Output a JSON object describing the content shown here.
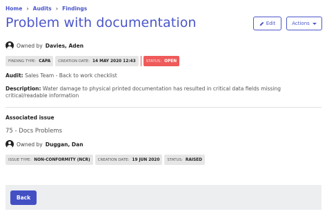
{
  "breadcrumb": [
    "Home",
    "Audits",
    "Findings"
  ],
  "title": "Problem with documentation",
  "actions": {
    "edit_label": "Edit",
    "actions_label": "Actions"
  },
  "finding": {
    "owner_prefix": "Owned by",
    "owner_name": "Davies, Aden",
    "tags": [
      {
        "label": "FINDING TYPE:",
        "value": "CAPA"
      },
      {
        "label": "CREATION DATE:",
        "value": "14 MAY 2020 12:43"
      },
      {
        "label": "STATUS:",
        "value": "OPEN"
      }
    ],
    "audit_label": "Audit:",
    "audit_value": "Sales Team - Back to work checklist",
    "description_label": "Description:",
    "description_value": "Water damage to physical printed documentation has resulted in critical data fields missing critical/readable information"
  },
  "associated": {
    "section_label": "Associated issue",
    "issue_title": "75 - Docs Problems",
    "owner_prefix": "Owned by",
    "owner_name": "Duggan, Dan",
    "tags": [
      {
        "label": "ISSUE TYPE:",
        "value": "NON-CONFORMITY (NCR)"
      },
      {
        "label": "CREATION DATE:",
        "value": "19 JUN 2020"
      },
      {
        "label": "STATUS:",
        "value": "RAISED"
      }
    ]
  },
  "footer": {
    "back_label": "Back"
  },
  "colors": {
    "primary": "#4a55c9",
    "status_open": "#ef5a5a",
    "tag_bg": "#e6e6e6"
  }
}
